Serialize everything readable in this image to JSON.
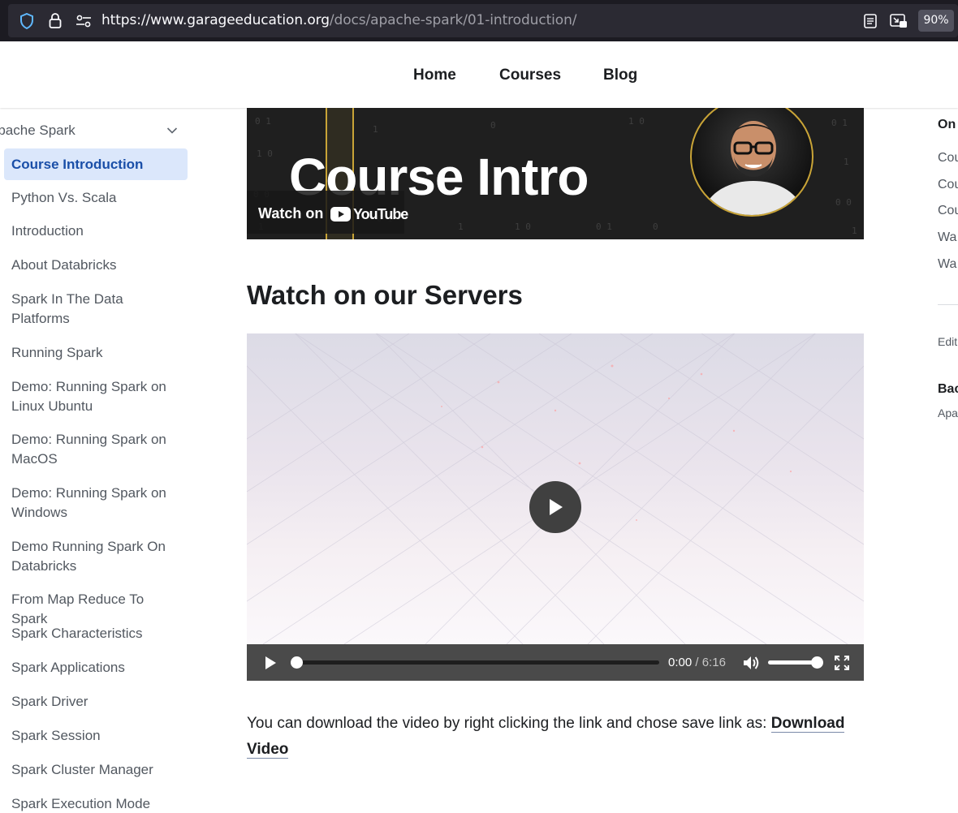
{
  "browser": {
    "url_domain": "https://www.garageeducation.org",
    "url_path": "/docs/apache-spark/01-introduction/",
    "zoom": "90%",
    "icons": [
      "shield-icon",
      "lock-icon",
      "permissions-icon",
      "reader-view-icon",
      "picture-in-picture-icon"
    ]
  },
  "nav": {
    "links": [
      "Home",
      "Courses",
      "Blog"
    ]
  },
  "sidebar": {
    "category": "Apache Spark",
    "items": [
      "Course Introduction",
      "Python Vs. Scala",
      "Introduction",
      "About Databricks",
      "Spark In The Data Platforms",
      "Running Spark",
      "Demo: Running Spark on Linux Ubuntu",
      "Demo: Running Spark on MacOS",
      "Demo: Running Spark on Windows",
      "Demo Running Spark On Databricks",
      "From Map Reduce To Spark",
      "Spark Characteristics",
      "Spark Applications",
      "Spark Driver",
      "Spark Session",
      "Spark Cluster Manager",
      "Spark Execution Mode"
    ],
    "active_index": 0
  },
  "youtube": {
    "title": "Course Intro",
    "watch_on": "Watch on",
    "logo_text": "YouTube"
  },
  "main": {
    "heading": "Watch on our Servers",
    "download_text": "You can download the video by right clicking the link and chose save link as: ",
    "download_link": "Download Video"
  },
  "video": {
    "current_time": "0:00",
    "separator": " / ",
    "duration": "6:16",
    "progress": 0,
    "volume": 1.0
  },
  "toc": {
    "heading": "On",
    "items": [
      "Cou",
      "Cou",
      "Cou",
      "Wa",
      "Wa"
    ],
    "edit": "Edit",
    "back": "Bac",
    "back_sub": "Apa"
  },
  "colors": {
    "active_bg": "#dbe7fb",
    "active_text": "#1a4fa8",
    "accent_gold": "#c9a437"
  }
}
